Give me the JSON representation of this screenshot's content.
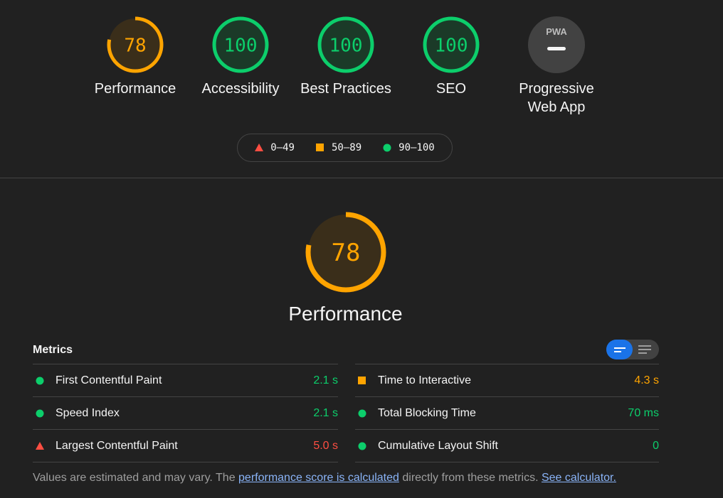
{
  "colors": {
    "pass": "#0cce6b",
    "average": "#ffa400",
    "fail": "#ff4e42",
    "pwa": "#757575"
  },
  "gauges": [
    {
      "score": "78",
      "label": "Performance",
      "state": "average",
      "fraction": 0.78
    },
    {
      "score": "100",
      "label": "Accessibility",
      "state": "pass",
      "fraction": 1.0
    },
    {
      "score": "100",
      "label": "Best Practices",
      "state": "pass",
      "fraction": 1.0
    },
    {
      "score": "100",
      "label": "SEO",
      "state": "pass",
      "fraction": 1.0
    }
  ],
  "pwa": {
    "badge_text": "PWA",
    "label_line1": "Progressive",
    "label_line2": "Web App"
  },
  "legend": {
    "fail": "0–49",
    "average": "50–89",
    "pass": "90–100"
  },
  "performance": {
    "score": "78",
    "fraction": 0.78,
    "title": "Performance"
  },
  "metrics": {
    "title": "Metrics",
    "left": [
      {
        "label": "First Contentful Paint",
        "value": "2.1 s",
        "state": "pass"
      },
      {
        "label": "Speed Index",
        "value": "2.1 s",
        "state": "pass"
      },
      {
        "label": "Largest Contentful Paint",
        "value": "5.0 s",
        "state": "fail"
      }
    ],
    "right": [
      {
        "label": "Time to Interactive",
        "value": "4.3 s",
        "state": "average"
      },
      {
        "label": "Total Blocking Time",
        "value": "70 ms",
        "state": "pass"
      },
      {
        "label": "Cumulative Layout Shift",
        "value": "0",
        "state": "pass"
      }
    ]
  },
  "footer": {
    "text1": "Values are estimated and may vary. The ",
    "link1": "performance score is calculated",
    "text2": " directly from these metrics. ",
    "link2": "See calculator."
  }
}
